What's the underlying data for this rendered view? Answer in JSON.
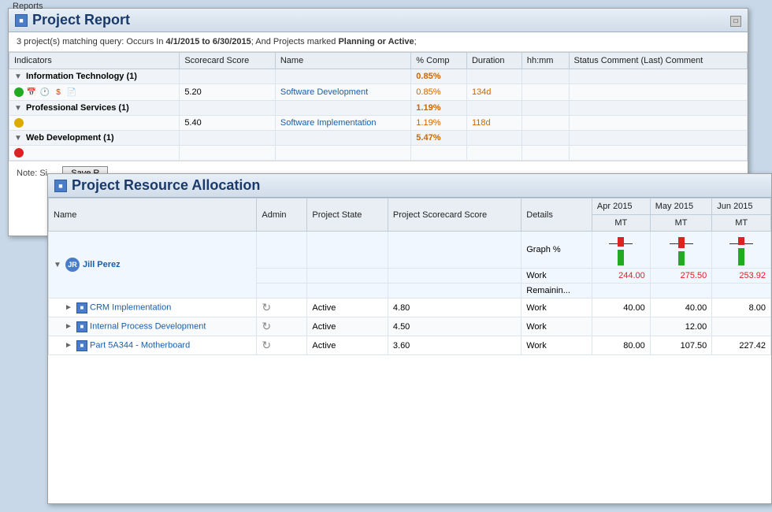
{
  "reportWindow": {
    "title": "Project Report",
    "icon": "R",
    "subtitle": {
      "prefix": "3 project(s) matching query: Occurs In ",
      "dateRange": "4/1/2015 to 6/30/2015",
      "separator": "; And Projects marked ",
      "statuses": "Planning or Active",
      "suffix": ";"
    },
    "columns": [
      "Indicators",
      "Scorecard Score",
      "Name",
      "% Comp",
      "Duration",
      "hh:mm",
      "Status Comment (Last) Comment"
    ],
    "groups": [
      {
        "name": "Information Technology (1)",
        "score": "",
        "pcomp": "0.85%",
        "duration": "",
        "items": [
          {
            "indicators": [
              "green",
              "calendar",
              "clock",
              "dollar",
              "document"
            ],
            "score": "5.20",
            "name": "Software Development",
            "pcomp": "0.85%",
            "duration": "134d",
            "hhmm": "",
            "comment": ""
          }
        ]
      },
      {
        "name": "Professional Services (1)",
        "score": "",
        "pcomp": "1.19%",
        "duration": "",
        "items": [
          {
            "indicators": [
              "yellow"
            ],
            "score": "5.40",
            "name": "Software Implementation",
            "pcomp": "1.19%",
            "duration": "118d",
            "hhmm": "",
            "comment": ""
          }
        ]
      },
      {
        "name": "Web Development (1)",
        "score": "",
        "pcomp": "5.47%",
        "duration": "",
        "items": []
      }
    ],
    "note": "Note: Si...",
    "saveButton": "Save R"
  },
  "resourceWindow": {
    "title": "Project Resource Allocation",
    "icon": "R",
    "columns": {
      "name": "Name",
      "admin": "Admin",
      "projectState": "Project State",
      "projectScore": "Project Scorecard Score",
      "details": "Details"
    },
    "months": [
      {
        "label": "Apr 2015",
        "sub": "MT"
      },
      {
        "label": "May 2015",
        "sub": "MT"
      },
      {
        "label": "Jun 2015",
        "sub": "MT"
      }
    ],
    "rows": [
      {
        "type": "person",
        "name": "Jill Perez",
        "admin": "",
        "projectState": "",
        "projectScore": "",
        "details": "",
        "subRows": [
          {
            "type": "metric",
            "label": "Graph %",
            "apr": "",
            "may": "",
            "jun": ""
          },
          {
            "type": "metric",
            "label": "Work",
            "apr": "244.00",
            "may": "275.50",
            "jun": "253.92",
            "aprColor": "red",
            "mayColor": "red",
            "junColor": "red"
          },
          {
            "type": "metric",
            "label": "Remainin...",
            "apr": "",
            "may": "",
            "jun": ""
          }
        ]
      },
      {
        "type": "project",
        "name": "CRM Implementation",
        "admin": "",
        "projectState": "Active",
        "projectScore": "4.80",
        "details": "Work",
        "apr": "40.00",
        "may": "40.00",
        "jun": "8.00"
      },
      {
        "type": "project",
        "name": "Internal Process Development",
        "admin": "",
        "projectState": "Active",
        "projectScore": "4.50",
        "details": "Work",
        "apr": "",
        "may": "12.00",
        "jun": ""
      },
      {
        "type": "project",
        "name": "Part 5A344 - Motherboard",
        "admin": "",
        "projectState": "Active",
        "projectScore": "3.60",
        "details": "Work",
        "apr": "80.00",
        "may": "107.50",
        "jun": "227.42"
      }
    ],
    "bars": {
      "apr": {
        "redHeight": 12,
        "greenHeight": 20
      },
      "may": {
        "redHeight": 14,
        "greenHeight": 18
      },
      "jun": {
        "redHeight": 10,
        "greenHeight": 22
      }
    }
  }
}
